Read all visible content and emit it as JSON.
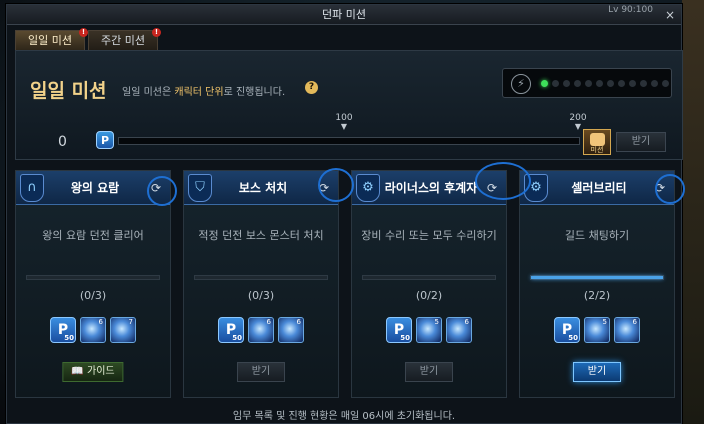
{
  "window": {
    "title": "던파 미션",
    "lv_text": "Lv 90:100",
    "close_label": "×"
  },
  "tabs": [
    {
      "label": "일일 미션",
      "badge": "!"
    },
    {
      "label": "주간 미션",
      "badge": "!"
    }
  ],
  "header": {
    "title": "일일 미션",
    "subtitle_prefix": "일일 미션은",
    "subtitle_highlight": "캐릭터 단위",
    "subtitle_suffix": "로 진행됩니다.",
    "help_label": "?",
    "status_indicators": [
      true,
      false,
      false,
      false,
      false,
      false,
      false,
      false,
      false,
      false,
      false,
      false
    ]
  },
  "progress": {
    "current_value": "0",
    "p_label": "P",
    "fill_fraction": 0,
    "marker_100": "100",
    "marker_200": "200",
    "reward_label": "미션",
    "claim_label": "받기"
  },
  "missions": [
    {
      "title": "왕의 요람",
      "icon": "gate-icon",
      "description": "왕의 요람 던전 클리어",
      "count": "(0/3)",
      "progress_fraction": 0,
      "rewards": {
        "p": "P",
        "p_num": "50",
        "gem1": "6",
        "gem2": "7"
      },
      "button_label": "📖 가이드",
      "button_kind": "guide"
    },
    {
      "title": "보스 처치",
      "icon": "shield-icon",
      "description": "적정 던전 보스 몬스터 처치",
      "count": "(0/3)",
      "progress_fraction": 0,
      "rewards": {
        "p": "P",
        "p_num": "50",
        "gem1": "6",
        "gem2": "6"
      },
      "button_label": "받기",
      "button_kind": "disabled"
    },
    {
      "title": "라이너스의 후계자",
      "icon": "gear-icon",
      "description": "장비 수리 또는 모두 수리하기",
      "count": "(0/2)",
      "progress_fraction": 0,
      "rewards": {
        "p": "P",
        "p_num": "50",
        "gem1": "5",
        "gem2": "6"
      },
      "button_label": "받기",
      "button_kind": "disabled"
    },
    {
      "title": "셀러브리티",
      "icon": "gear-icon",
      "description": "길드 채팅하기",
      "count": "(2/2)",
      "progress_fraction": 1,
      "rewards": {
        "p": "P",
        "p_num": "50",
        "gem1": "5",
        "gem2": "6"
      },
      "button_label": "받기",
      "button_kind": "active"
    }
  ],
  "footer": {
    "note": "임무 목록 및 진행 현황은 매일 06시에 초기화됩니다."
  },
  "colors": {
    "accent": "#2a8ad8",
    "title_gold": "#f2d28a",
    "card_header": "#1c3f6a",
    "annotation_blue": "#1e6fd2"
  }
}
